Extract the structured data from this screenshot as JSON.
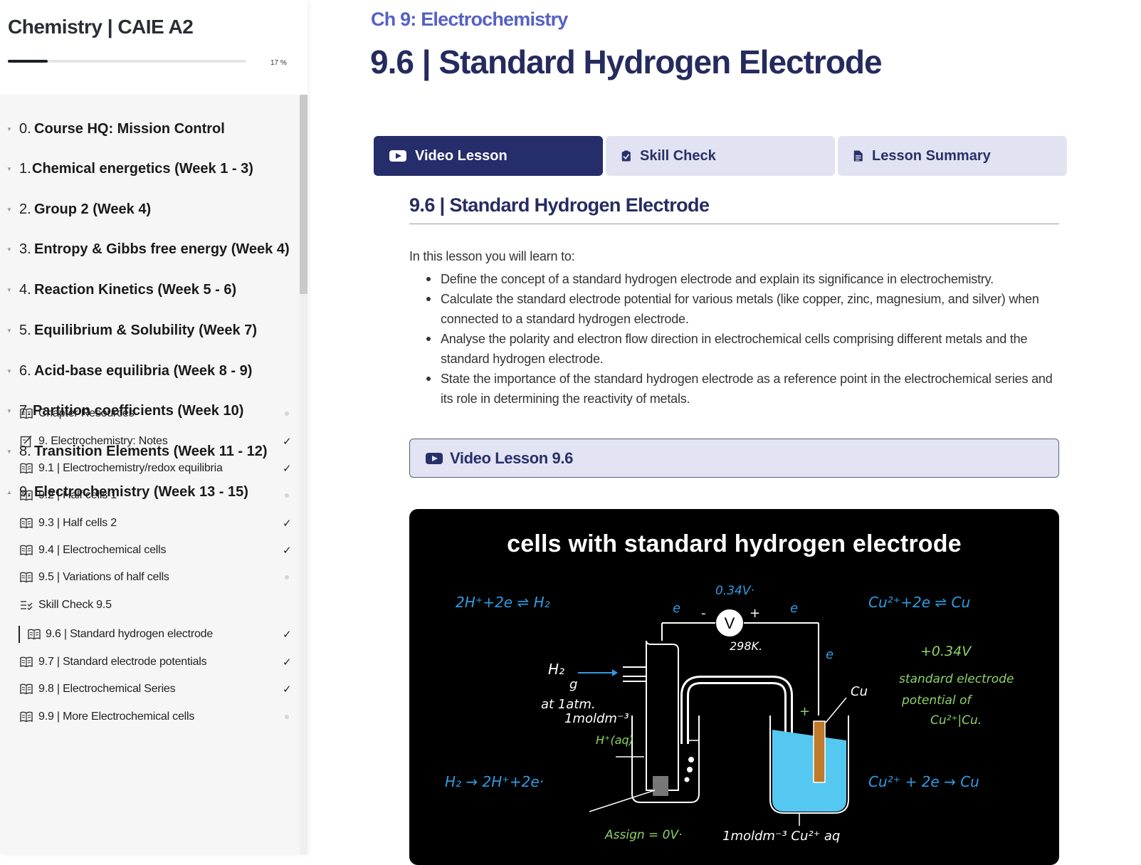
{
  "sidebar": {
    "course_title": "Chemistry | CAIE A2",
    "progress_percent": 17,
    "progress_text": "17 %",
    "chapters": [
      {
        "num": "0.",
        "name": "Course HQ: Mission Control"
      },
      {
        "num": "1.",
        "name": "Chemical energetics (Week 1 - 3)"
      },
      {
        "num": "2.",
        "name": "Group 2 (Week 4)"
      },
      {
        "num": "3.",
        "name": "Entropy & Gibbs free energy (Week 4)"
      },
      {
        "num": "4.",
        "name": "Reaction Kinetics (Week 5 - 6)"
      },
      {
        "num": "5.",
        "name": "Equilibrium & Solubility (Week 7)"
      },
      {
        "num": "6.",
        "name": "Acid-base equilibria (Week 8 - 9)"
      },
      {
        "num": "7.",
        "name": "Partition coefficients (Week 10)"
      },
      {
        "num": "8.",
        "name": "Transition Elements (Week 11 - 12)"
      },
      {
        "num": "9.",
        "name": "Electrochemistry (Week 13 - 15)"
      }
    ],
    "lessons": [
      {
        "name": "Chapter Resources",
        "icon": "book-icon",
        "status": "incomplete"
      },
      {
        "name": "9. Electrochemistry: Notes",
        "icon": "edit-note-icon",
        "status": "complete"
      },
      {
        "name": "9.1 | Electrochemistry/redox equilibria",
        "icon": "book-icon",
        "status": "complete"
      },
      {
        "name": "9.2 | Half cells 1",
        "icon": "book-icon",
        "status": "incomplete"
      },
      {
        "name": "9.3 | Half cells 2",
        "icon": "book-icon",
        "status": "complete"
      },
      {
        "name": "9.4 | Electrochemical cells",
        "icon": "book-icon",
        "status": "complete"
      },
      {
        "name": "9.5 | Variations of half cells",
        "icon": "book-icon",
        "status": "incomplete"
      },
      {
        "name": "Skill Check 9.5",
        "icon": "checklist-icon",
        "status": "none"
      },
      {
        "name": "9.6 | Standard hydrogen electrode",
        "icon": "book-icon",
        "status": "complete",
        "active": true
      },
      {
        "name": "9.7 | Standard electrode potentials",
        "icon": "book-icon",
        "status": "complete"
      },
      {
        "name": "9.8 | Electrochemical Series",
        "icon": "book-icon",
        "status": "complete"
      },
      {
        "name": "9.9 | More Electrochemical cells",
        "icon": "book-icon",
        "status": "incomplete"
      }
    ],
    "check_glyph": "✓"
  },
  "main": {
    "chapter_label": "Ch 9: Electrochemistry",
    "lesson_title": "9.6 | Standard Hydrogen Electrode",
    "tabs": [
      {
        "label": "Video Lesson",
        "icon": "youtube-icon",
        "active": true
      },
      {
        "label": "Skill Check",
        "icon": "clipboard-check-icon",
        "active": false
      },
      {
        "label": "Lesson Summary",
        "icon": "document-icon",
        "active": false
      }
    ],
    "section_heading": "9.6 | Standard Hydrogen Electrode",
    "intro": "In this lesson you will learn to:",
    "objectives": [
      "Define the concept of a standard hydrogen electrode and explain its significance in electrochemistry.",
      "Calculate the standard electrode potential for various metals (like copper, zinc, magnesium, and silver) when connected to a standard hydrogen electrode.",
      "Analyse the polarity and electron flow direction in electrochemical cells comprising different metals and the standard hydrogen electrode.",
      "State the importance of the standard hydrogen electrode as a reference point in the electrochemical series and its role in determining the reactivity of metals."
    ],
    "video_bar_label": "Video Lesson 9.6",
    "video": {
      "title": "cells with standard hydrogen electrode",
      "voltage": "0.34V·",
      "voltmeter": "V",
      "temperature": "298K.",
      "eq_left_top": "2H⁺+2e ⇌ H₂",
      "eq_right_top": "Cu²⁺+2e ⇌ Cu",
      "eq_left_bottom": "H₂ → 2H⁺+2e·",
      "eq_right_bottom": "Cu²⁺ + 2e → Cu",
      "e_left": "e",
      "e_right": "e",
      "e_down": "e",
      "minus": "-",
      "plus": "+",
      "h2_label": "H₂",
      "g_label": "g",
      "pressure": "at 1atm.",
      "concentration_left": "1moldm⁻³",
      "h_ion": "H⁺(aq)",
      "cu_label": "Cu",
      "plus_cell": "+",
      "emf": "+0.34V",
      "green_1": "standard electrode",
      "green_2": "potential of",
      "green_3": "Cu²⁺|Cu.",
      "assign": "Assign = 0V·",
      "concentration_right": "1moldm⁻³ Cu²⁺ aq"
    },
    "colors": {
      "primary": "#262d6b",
      "accent": "#5561c6",
      "tab_inactive": "#e1e3f2",
      "handwriting_blue": "#2f9be0",
      "handwriting_green": "#8ed26a",
      "solution": "#54c8f0",
      "copper_rod": "#c07a2a"
    }
  }
}
